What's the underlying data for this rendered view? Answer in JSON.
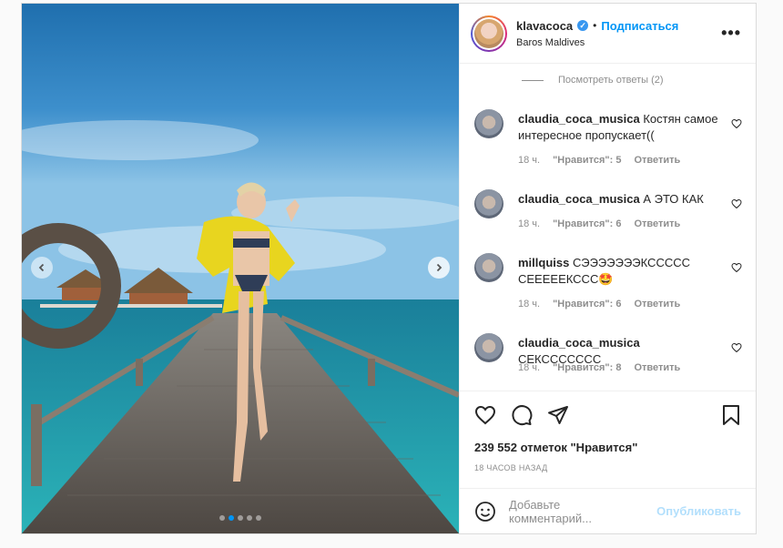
{
  "post": {
    "username": "klavacoca",
    "follow_label": "Подписаться",
    "bullet": "•",
    "location": "Baros Maldives",
    "more_label": "•••",
    "verified_mark": "✓"
  },
  "comments": {
    "view_replies": "Посмотреть ответы (2)",
    "items": [
      {
        "user": "claudia_coca_musica",
        "text": "Костян самое интересное пропускает((",
        "time": "18 ч.",
        "likes": "\"Нравится\": 5",
        "reply": "Ответить"
      },
      {
        "user": "claudia_coca_musica",
        "text": "А ЭТО КАК",
        "time": "18 ч.",
        "likes": "\"Нравится\": 6",
        "reply": "Ответить"
      },
      {
        "user": "millquiss",
        "text": "СЭЭЭЭЭЭЭКССССС СЕЕЕЕЕКССС🤩",
        "time": "18 ч.",
        "likes": "\"Нравится\": 6",
        "reply": "Ответить"
      },
      {
        "user": "claudia_coca_musica",
        "text": "СЕКССССССС",
        "time": "18 ч.",
        "likes": "\"Нравится\": 8",
        "reply": "Ответить"
      }
    ]
  },
  "actions": {
    "likes_text": "239 552 отметок \"Нравится\"",
    "date_text": "18 ЧАСОВ НАЗАД"
  },
  "add_comment": {
    "placeholder": "Добавьте комментарий...",
    "publish_label": "Опубликовать"
  },
  "carousel": {
    "slide_count": 5,
    "active_index": 1
  },
  "icons": {
    "like": "heart-icon",
    "comment": "comment-bubble-icon",
    "share": "paper-plane-icon",
    "save": "bookmark-icon",
    "emoji": "smiley-icon",
    "next": "chevron-right-icon",
    "prev": "chevron-left-icon"
  },
  "colors": {
    "accent": "#0095f6",
    "muted": "#8e8e8e",
    "publish_disabled": "#b2dffc"
  }
}
